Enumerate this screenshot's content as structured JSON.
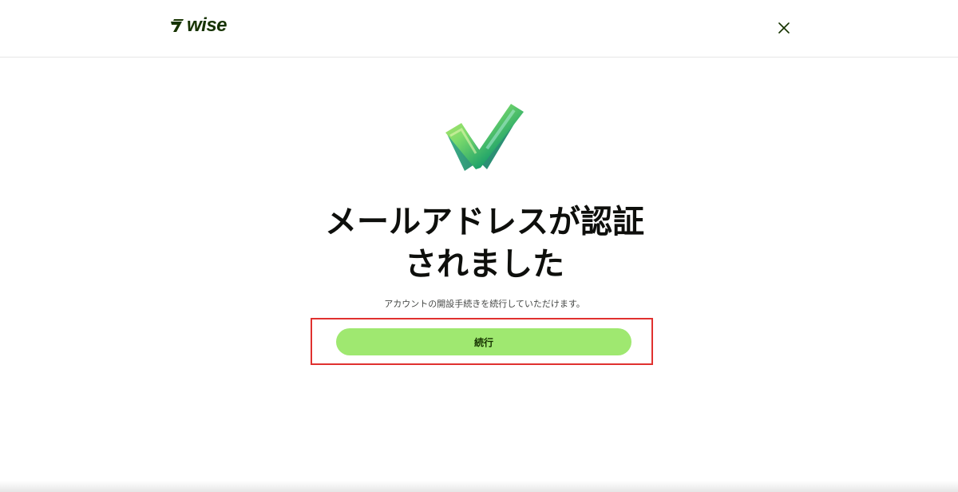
{
  "header": {
    "logo_text": "wise",
    "close_icon": "close-icon"
  },
  "illustration": {
    "icon": "checkmark-icon",
    "colors": [
      "#1fa36a",
      "#7ddb6b",
      "#4fc6c9",
      "#c7e86b"
    ]
  },
  "main": {
    "title_line1": "メールアドレスが認証",
    "title_line2": "されました",
    "subtitle": "アカウントの開設手続きを続行していただけます。",
    "continue_label": "続行"
  },
  "colors": {
    "brand": "#163300",
    "button_bg": "#9fe870",
    "highlight": "#e0312f"
  }
}
